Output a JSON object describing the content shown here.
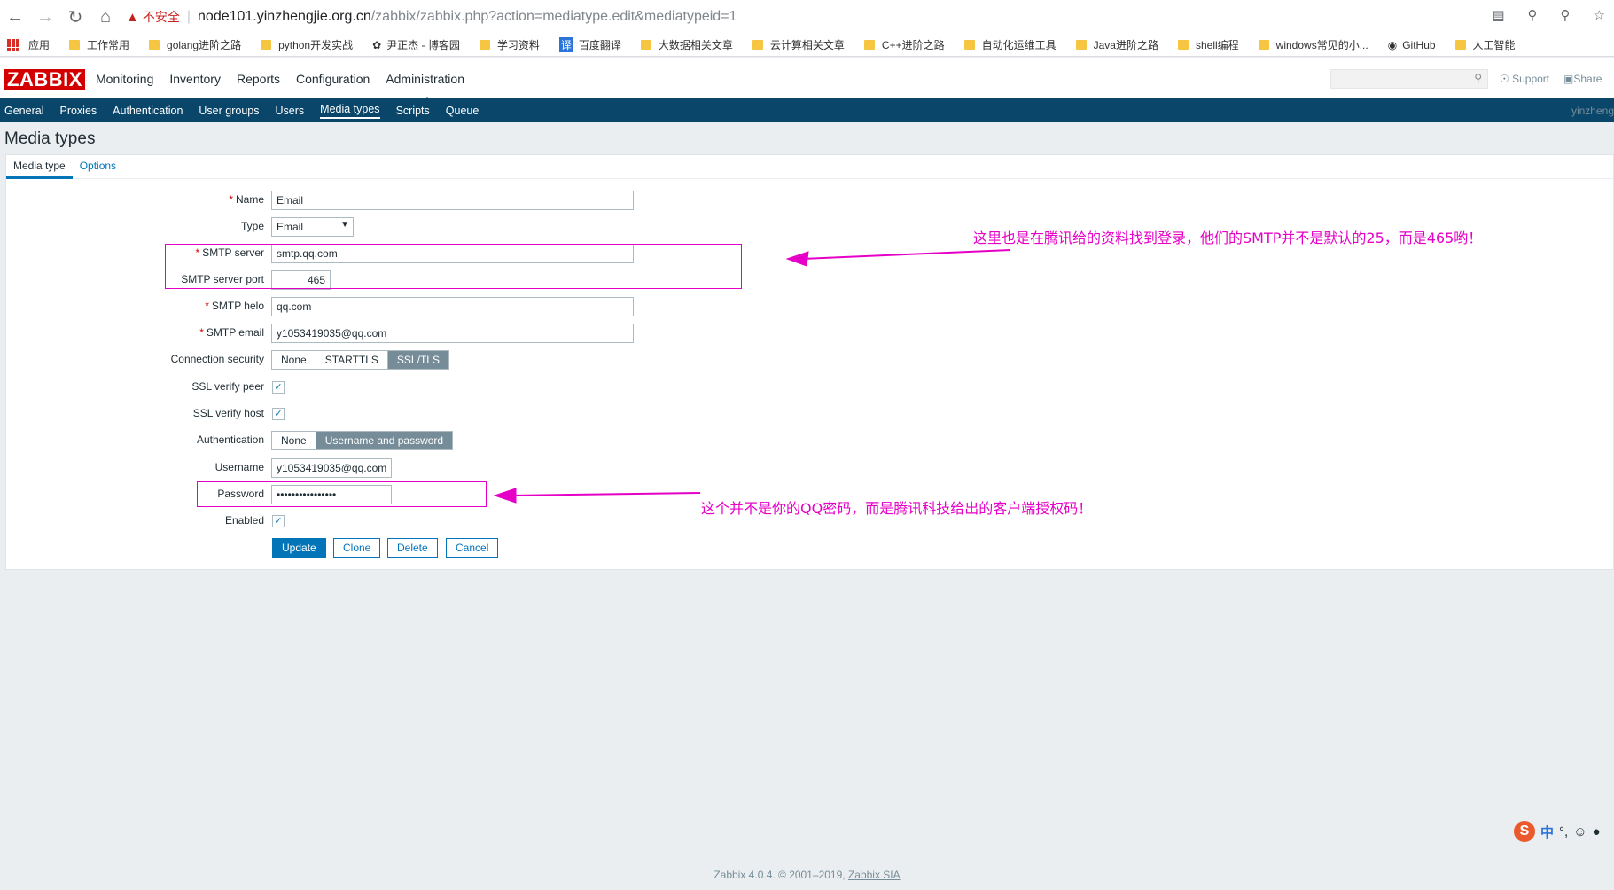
{
  "browser": {
    "insecure_label": "不安全",
    "url_host": "node101.yinzhengjie.org.cn",
    "url_path": "/zabbix/zabbix.php?action=mediatype.edit&mediatypeid=1",
    "bookmarks": [
      "应用",
      "工作常用",
      "golang进阶之路",
      "python开发实战",
      "尹正杰 - 博客园",
      "学习资料",
      "百度翻译",
      "大数据相关文章",
      "云计算相关文章",
      "C++进阶之路",
      "自动化运维工具",
      "Java进阶之路",
      "shell编程",
      "windows常见的小...",
      "GitHub",
      "人工智能"
    ]
  },
  "topnav": {
    "logo": "ZABBIX",
    "menu": [
      "Monitoring",
      "Inventory",
      "Reports",
      "Configuration",
      "Administration"
    ],
    "support": "Support",
    "share": "Share"
  },
  "subnav": {
    "items": [
      "General",
      "Proxies",
      "Authentication",
      "User groups",
      "Users",
      "Media types",
      "Scripts",
      "Queue"
    ],
    "user": "yinzheng"
  },
  "page": {
    "title": "Media types",
    "tabs": [
      "Media type",
      "Options"
    ]
  },
  "form": {
    "name_label": "Name",
    "name_value": "Email",
    "type_label": "Type",
    "type_value": "Email",
    "smtp_server_label": "SMTP server",
    "smtp_server_value": "smtp.qq.com",
    "smtp_port_label": "SMTP server port",
    "smtp_port_value": "465",
    "smtp_helo_label": "SMTP helo",
    "smtp_helo_value": "qq.com",
    "smtp_email_label": "SMTP email",
    "smtp_email_value": "y1053419035@qq.com",
    "conn_security_label": "Connection security",
    "conn_security_options": [
      "None",
      "STARTTLS",
      "SSL/TLS"
    ],
    "ssl_peer_label": "SSL verify peer",
    "ssl_host_label": "SSL verify host",
    "auth_label": "Authentication",
    "auth_options": [
      "None",
      "Username and password"
    ],
    "username_label": "Username",
    "username_value": "y1053419035@qq.com",
    "password_label": "Password",
    "password_value": "••••••••••••••••",
    "enabled_label": "Enabled",
    "buttons": {
      "update": "Update",
      "clone": "Clone",
      "delete": "Delete",
      "cancel": "Cancel"
    }
  },
  "annotations": {
    "smtp_note": "这里也是在腾讯给的资料找到登录，他们的SMTP并不是默认的25，而是465哟！",
    "password_note": "这个并不是你的QQ密码，而是腾讯科技给出的客户端授权码！"
  },
  "footer": {
    "text": "Zabbix 4.0.4. © 2001–2019, ",
    "link": "Zabbix SIA"
  },
  "ime": {
    "label": "中"
  },
  "colors": {
    "annotation": "#e600c7",
    "zabbix_red": "#d40000",
    "subnav_bg": "#0a466a",
    "link": "#0275b8"
  }
}
